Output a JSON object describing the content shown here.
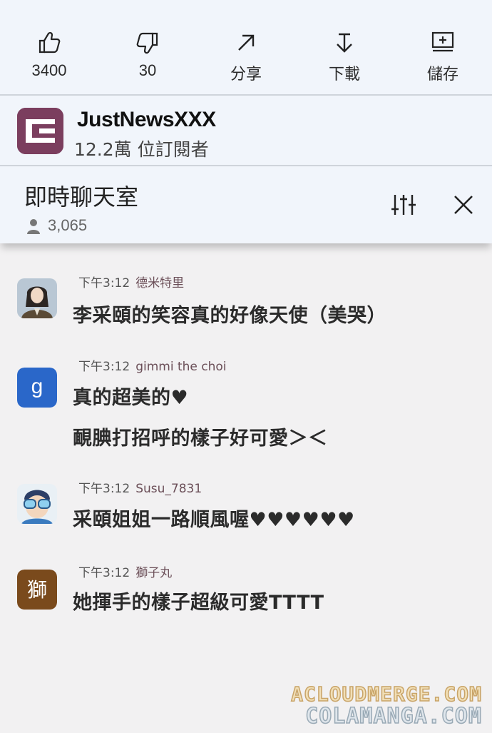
{
  "actions": [
    {
      "label": "3400",
      "icon": "thumbs-up-icon"
    },
    {
      "label": "30",
      "icon": "thumbs-down-icon"
    },
    {
      "label": "分享",
      "icon": "share-icon"
    },
    {
      "label": "下載",
      "icon": "download-icon"
    },
    {
      "label": "儲存",
      "icon": "save-to-playlist-icon"
    }
  ],
  "channel": {
    "name": "JustNewsXXX",
    "subscribers": "12.2萬 位訂閱者",
    "logo_color": "#7b3e5e"
  },
  "live_chat": {
    "title": "即時聊天室",
    "viewer_count": "3,065"
  },
  "messages": [
    {
      "time": "下午3:12",
      "author": "德米特里",
      "lines": [
        "李采頤的笑容真的好像天使（美哭）"
      ],
      "avatar": "woman-in-suit-avatar"
    },
    {
      "time": "下午3:12",
      "author": "gimmi the choi",
      "lines": [
        "真的超美的♥",
        "靦腆打招呼的樣子好可愛＞＜"
      ],
      "avatar": "letter-g-avatar",
      "avatar_letter": "g",
      "avatar_color": "#2a67c9"
    },
    {
      "time": "下午3:12",
      "author": "Susu_7831",
      "lines": [
        "采頤姐姐一路順風喔♥♥♥♥♥♥"
      ],
      "avatar": "goggles-boy-avatar"
    },
    {
      "time": "下午3:12",
      "author": "獅子丸",
      "lines": [
        "她揮手的樣子超級可愛TTTT"
      ],
      "avatar": "lion-char-avatar",
      "avatar_letter": "獅",
      "avatar_color": "#7a4a1c"
    }
  ],
  "watermark": {
    "line1": "ACLOUDMERGE.COM",
    "line2": "COLAMANGA.COM"
  }
}
